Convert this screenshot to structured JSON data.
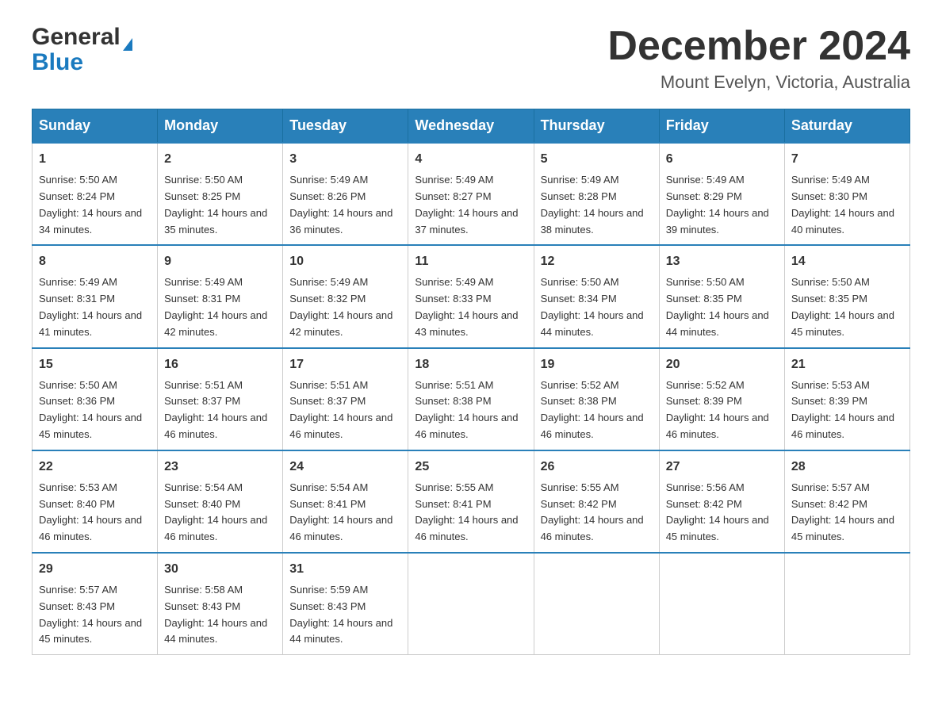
{
  "header": {
    "month_title": "December 2024",
    "location": "Mount Evelyn, Victoria, Australia",
    "logo_general": "General",
    "logo_blue": "Blue"
  },
  "days_of_week": [
    "Sunday",
    "Monday",
    "Tuesday",
    "Wednesday",
    "Thursday",
    "Friday",
    "Saturday"
  ],
  "weeks": [
    [
      {
        "day": "1",
        "sunrise": "Sunrise: 5:50 AM",
        "sunset": "Sunset: 8:24 PM",
        "daylight": "Daylight: 14 hours and 34 minutes."
      },
      {
        "day": "2",
        "sunrise": "Sunrise: 5:50 AM",
        "sunset": "Sunset: 8:25 PM",
        "daylight": "Daylight: 14 hours and 35 minutes."
      },
      {
        "day": "3",
        "sunrise": "Sunrise: 5:49 AM",
        "sunset": "Sunset: 8:26 PM",
        "daylight": "Daylight: 14 hours and 36 minutes."
      },
      {
        "day": "4",
        "sunrise": "Sunrise: 5:49 AM",
        "sunset": "Sunset: 8:27 PM",
        "daylight": "Daylight: 14 hours and 37 minutes."
      },
      {
        "day": "5",
        "sunrise": "Sunrise: 5:49 AM",
        "sunset": "Sunset: 8:28 PM",
        "daylight": "Daylight: 14 hours and 38 minutes."
      },
      {
        "day": "6",
        "sunrise": "Sunrise: 5:49 AM",
        "sunset": "Sunset: 8:29 PM",
        "daylight": "Daylight: 14 hours and 39 minutes."
      },
      {
        "day": "7",
        "sunrise": "Sunrise: 5:49 AM",
        "sunset": "Sunset: 8:30 PM",
        "daylight": "Daylight: 14 hours and 40 minutes."
      }
    ],
    [
      {
        "day": "8",
        "sunrise": "Sunrise: 5:49 AM",
        "sunset": "Sunset: 8:31 PM",
        "daylight": "Daylight: 14 hours and 41 minutes."
      },
      {
        "day": "9",
        "sunrise": "Sunrise: 5:49 AM",
        "sunset": "Sunset: 8:31 PM",
        "daylight": "Daylight: 14 hours and 42 minutes."
      },
      {
        "day": "10",
        "sunrise": "Sunrise: 5:49 AM",
        "sunset": "Sunset: 8:32 PM",
        "daylight": "Daylight: 14 hours and 42 minutes."
      },
      {
        "day": "11",
        "sunrise": "Sunrise: 5:49 AM",
        "sunset": "Sunset: 8:33 PM",
        "daylight": "Daylight: 14 hours and 43 minutes."
      },
      {
        "day": "12",
        "sunrise": "Sunrise: 5:50 AM",
        "sunset": "Sunset: 8:34 PM",
        "daylight": "Daylight: 14 hours and 44 minutes."
      },
      {
        "day": "13",
        "sunrise": "Sunrise: 5:50 AM",
        "sunset": "Sunset: 8:35 PM",
        "daylight": "Daylight: 14 hours and 44 minutes."
      },
      {
        "day": "14",
        "sunrise": "Sunrise: 5:50 AM",
        "sunset": "Sunset: 8:35 PM",
        "daylight": "Daylight: 14 hours and 45 minutes."
      }
    ],
    [
      {
        "day": "15",
        "sunrise": "Sunrise: 5:50 AM",
        "sunset": "Sunset: 8:36 PM",
        "daylight": "Daylight: 14 hours and 45 minutes."
      },
      {
        "day": "16",
        "sunrise": "Sunrise: 5:51 AM",
        "sunset": "Sunset: 8:37 PM",
        "daylight": "Daylight: 14 hours and 46 minutes."
      },
      {
        "day": "17",
        "sunrise": "Sunrise: 5:51 AM",
        "sunset": "Sunset: 8:37 PM",
        "daylight": "Daylight: 14 hours and 46 minutes."
      },
      {
        "day": "18",
        "sunrise": "Sunrise: 5:51 AM",
        "sunset": "Sunset: 8:38 PM",
        "daylight": "Daylight: 14 hours and 46 minutes."
      },
      {
        "day": "19",
        "sunrise": "Sunrise: 5:52 AM",
        "sunset": "Sunset: 8:38 PM",
        "daylight": "Daylight: 14 hours and 46 minutes."
      },
      {
        "day": "20",
        "sunrise": "Sunrise: 5:52 AM",
        "sunset": "Sunset: 8:39 PM",
        "daylight": "Daylight: 14 hours and 46 minutes."
      },
      {
        "day": "21",
        "sunrise": "Sunrise: 5:53 AM",
        "sunset": "Sunset: 8:39 PM",
        "daylight": "Daylight: 14 hours and 46 minutes."
      }
    ],
    [
      {
        "day": "22",
        "sunrise": "Sunrise: 5:53 AM",
        "sunset": "Sunset: 8:40 PM",
        "daylight": "Daylight: 14 hours and 46 minutes."
      },
      {
        "day": "23",
        "sunrise": "Sunrise: 5:54 AM",
        "sunset": "Sunset: 8:40 PM",
        "daylight": "Daylight: 14 hours and 46 minutes."
      },
      {
        "day": "24",
        "sunrise": "Sunrise: 5:54 AM",
        "sunset": "Sunset: 8:41 PM",
        "daylight": "Daylight: 14 hours and 46 minutes."
      },
      {
        "day": "25",
        "sunrise": "Sunrise: 5:55 AM",
        "sunset": "Sunset: 8:41 PM",
        "daylight": "Daylight: 14 hours and 46 minutes."
      },
      {
        "day": "26",
        "sunrise": "Sunrise: 5:55 AM",
        "sunset": "Sunset: 8:42 PM",
        "daylight": "Daylight: 14 hours and 46 minutes."
      },
      {
        "day": "27",
        "sunrise": "Sunrise: 5:56 AM",
        "sunset": "Sunset: 8:42 PM",
        "daylight": "Daylight: 14 hours and 45 minutes."
      },
      {
        "day": "28",
        "sunrise": "Sunrise: 5:57 AM",
        "sunset": "Sunset: 8:42 PM",
        "daylight": "Daylight: 14 hours and 45 minutes."
      }
    ],
    [
      {
        "day": "29",
        "sunrise": "Sunrise: 5:57 AM",
        "sunset": "Sunset: 8:43 PM",
        "daylight": "Daylight: 14 hours and 45 minutes."
      },
      {
        "day": "30",
        "sunrise": "Sunrise: 5:58 AM",
        "sunset": "Sunset: 8:43 PM",
        "daylight": "Daylight: 14 hours and 44 minutes."
      },
      {
        "day": "31",
        "sunrise": "Sunrise: 5:59 AM",
        "sunset": "Sunset: 8:43 PM",
        "daylight": "Daylight: 14 hours and 44 minutes."
      },
      null,
      null,
      null,
      null
    ]
  ]
}
